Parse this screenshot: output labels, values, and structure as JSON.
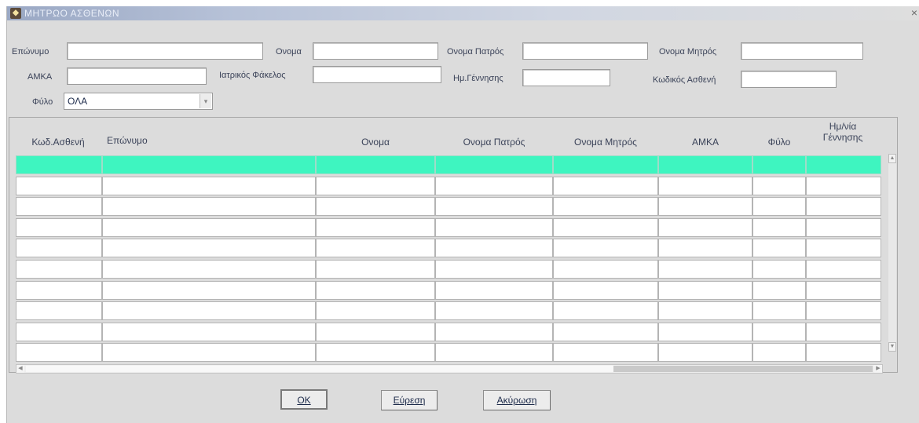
{
  "window": {
    "title": "ΜΗΤΡΩΟ ΑΣΘΕΝΩΝ",
    "close": "×"
  },
  "form": {
    "surname_label": "Επώνυμο",
    "name_label": "Ονομα",
    "father_label": "Ονομα Πατρός",
    "mother_label": "Ονομα Μητρός",
    "amka_label": "ΑΜΚΑ",
    "medical_file_label": "Ιατρικός Φάκελος",
    "birth_label": "Ημ.Γέννησης",
    "patient_code_label": "Κωδικός Ασθενή",
    "sex_label": "Φύλο",
    "sex_value": "ΟΛΑ"
  },
  "table": {
    "columns": [
      "Κωδ.Ασθενή",
      "Επώνυμο",
      "Ονομα",
      "Ονομα Πατρός",
      "Ονομα Μητρός",
      "ΑΜΚΑ",
      "Φύλο",
      "Ημ/νία",
      "Γέννησης"
    ],
    "row_count": 10
  },
  "buttons": {
    "ok": "OK",
    "find": "Εύρεση",
    "cancel": "Ακύρωση"
  },
  "colors": {
    "selected_row": "#3ef5c0",
    "title_bar": "#9aa8c4",
    "background": "#dcdcdc"
  }
}
